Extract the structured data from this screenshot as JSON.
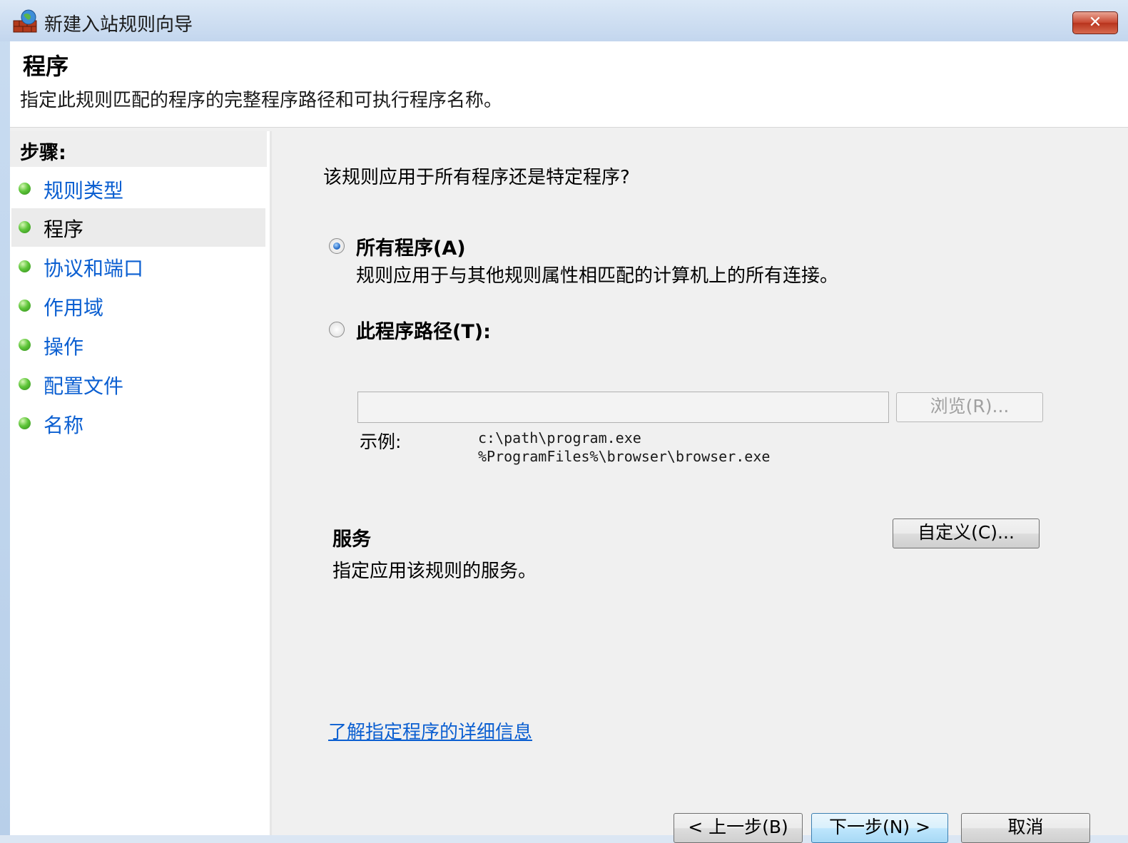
{
  "window": {
    "title": "新建入站规则向导",
    "close_label": "✕"
  },
  "header": {
    "title": "程序",
    "description": "指定此规则匹配的程序的完整程序路径和可执行程序名称。"
  },
  "sidebar": {
    "heading": "步骤:",
    "steps": [
      {
        "label": "规则类型"
      },
      {
        "label": "程序"
      },
      {
        "label": "协议和端口"
      },
      {
        "label": "作用域"
      },
      {
        "label": "操作"
      },
      {
        "label": "配置文件"
      },
      {
        "label": "名称"
      }
    ]
  },
  "main": {
    "question": "该规则应用于所有程序还是特定程序?",
    "all_programs": {
      "label": "所有程序(A)",
      "description": "规则应用于与其他规则属性相匹配的计算机上的所有连接。"
    },
    "this_path": {
      "label": "此程序路径(T):",
      "value": "",
      "browse_label": "浏览(R)..."
    },
    "example": {
      "label": "示例:",
      "lines": [
        "c:\\path\\program.exe",
        "%ProgramFiles%\\browser\\browser.exe"
      ]
    },
    "services": {
      "title": "服务",
      "description": "指定应用该规则的服务。",
      "customize_label": "自定义(C)..."
    },
    "help_link": "了解指定程序的详细信息"
  },
  "footer": {
    "back_label": "< 上一步(B)",
    "next_label": "下一步(N) >",
    "cancel_label": "取消"
  }
}
